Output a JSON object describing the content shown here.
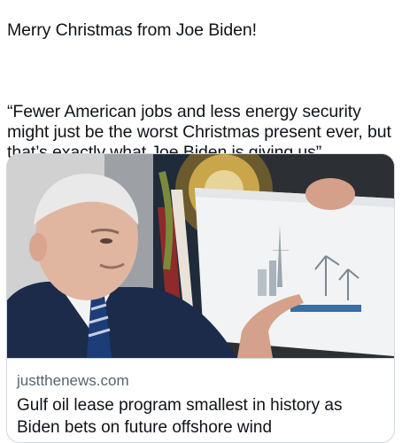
{
  "post": {
    "line1": "Merry Christmas from Joe Biden!",
    "quote": "“Fewer American jobs and less energy security might just be the worst Christmas present ever, but that’s exactly what Joe Biden is giving us”"
  },
  "card": {
    "domain": "justthenews.com",
    "headline": "Gulf oil lease program smallest in history as Biden bets on future offshore wind"
  },
  "colors": {
    "text": "#0f1419",
    "secondary_text": "#536471",
    "border": "#cfd9de"
  }
}
